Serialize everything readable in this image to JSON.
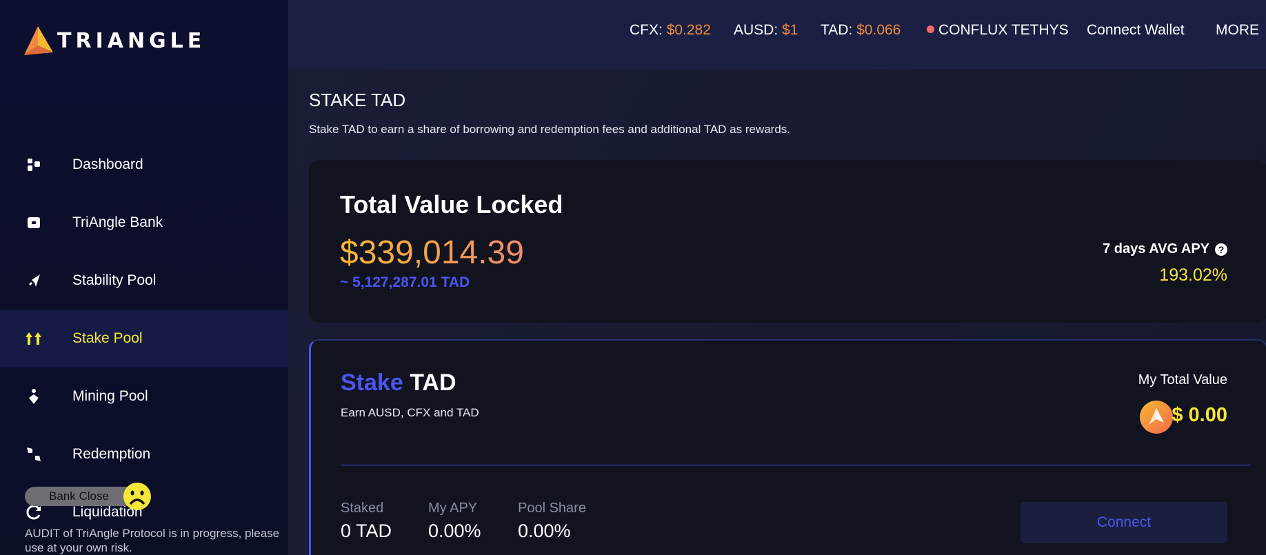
{
  "brand": {
    "name": "TRIANGLE"
  },
  "sidebar": {
    "items": [
      {
        "label": "Dashboard",
        "icon": "dashboard-icon",
        "active": false
      },
      {
        "label": "TriAngle Bank",
        "icon": "bank-icon",
        "active": false
      },
      {
        "label": "Stability Pool",
        "icon": "rocket-icon",
        "active": false
      },
      {
        "label": "Stake Pool",
        "icon": "arrows-up-icon",
        "active": true
      },
      {
        "label": "Mining Pool",
        "icon": "mining-icon",
        "active": false
      },
      {
        "label": "Redemption",
        "icon": "collapse-icon",
        "active": false
      },
      {
        "label": "Liquidation",
        "icon": "refresh-icon",
        "active": false
      }
    ],
    "bank_status": "Bank Close",
    "audit_notice": "AUDIT of TriAngle Protocol is in progress, please use at your own risk."
  },
  "topbar": {
    "cfx_label": "CFX:",
    "cfx_price": "$0.282",
    "ausd_label": "AUSD:",
    "ausd_price": "$1",
    "tad_label": "TAD:",
    "tad_price": "$0.066",
    "network": "CONFLUX TETHYS",
    "connect_wallet": "Connect Wallet",
    "more": "MORE"
  },
  "page": {
    "title": "STAKE TAD",
    "description": "Stake TAD to earn a share of borrowing and redemption fees and additional TAD as rewards."
  },
  "tvl": {
    "title": "Total Value Locked",
    "value": "$339,014.39",
    "sub": "~ 5,127,287.01 TAD",
    "apy_label": "7 days AVG APY",
    "apy_value": "193.02%"
  },
  "stake": {
    "title_highlight": "Stake",
    "title_rest": "TAD",
    "subtitle": "Earn AUSD, CFX and TAD",
    "total_value_label": "My Total Value",
    "total_value": "$ 0.00",
    "stats": [
      {
        "label": "Staked",
        "value": "0 TAD"
      },
      {
        "label": "My APY",
        "value": "0.00%"
      },
      {
        "label": "Pool Share",
        "value": "0.00%"
      }
    ],
    "connect": "Connect"
  },
  "colors": {
    "accent": "#4b55f0",
    "highlight": "#f5e63a",
    "price": "#f08a3c"
  }
}
